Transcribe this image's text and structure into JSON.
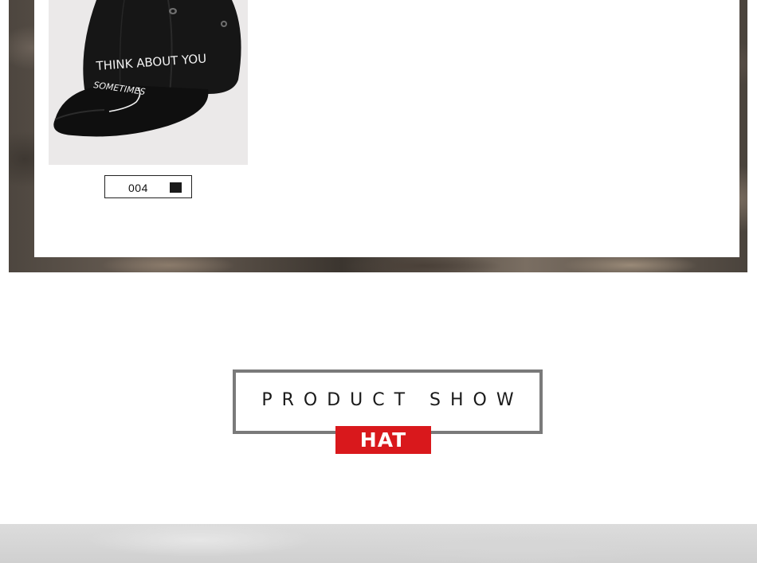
{
  "product_card": {
    "image_alt": "black baseball cap with embroidered text",
    "cap_text_front": "THINK  ABOUT YOU",
    "cap_text_brim": "SOMETIMES",
    "color_code": "004",
    "color_swatch_hex": "#1a1a1a"
  },
  "section_heading": {
    "title": "PRODUCT SHOW",
    "tag": "HAT",
    "tag_color": "#d9181c",
    "frame_color": "#7a7a7a"
  }
}
